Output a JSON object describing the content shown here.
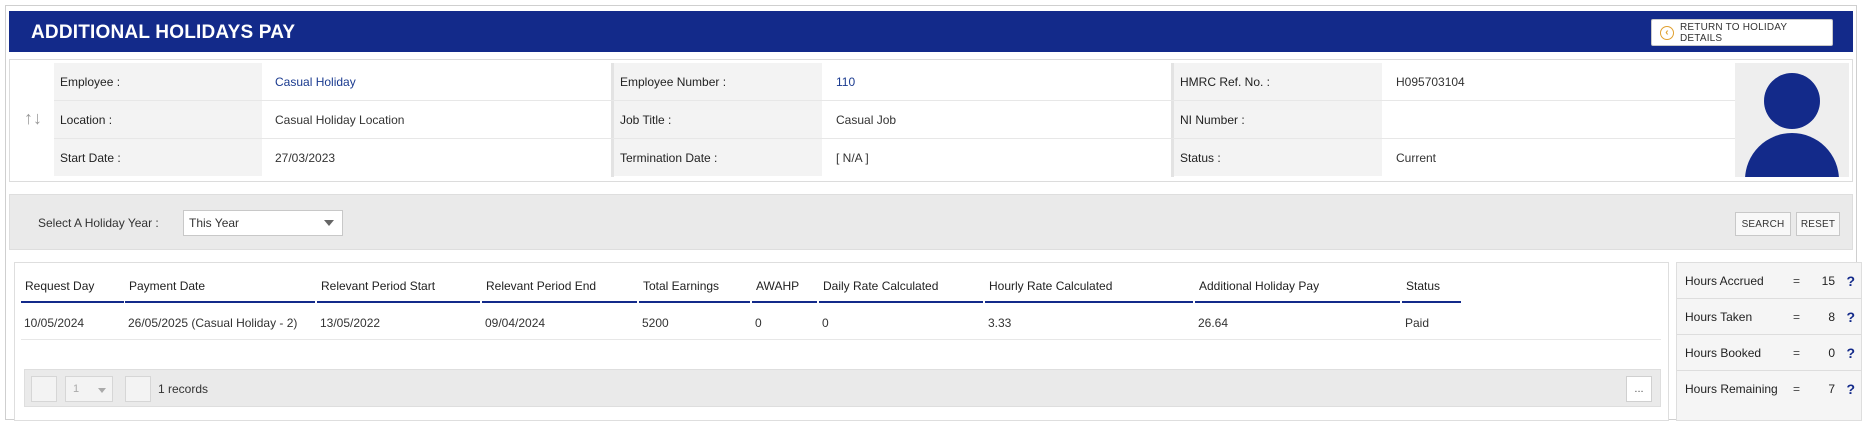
{
  "header": {
    "title": "ADDITIONAL HOLIDAYS PAY",
    "return_label": "RETURN TO HOLIDAY DETAILS",
    "return_icon": "chevron-left-circle-icon",
    "bar_color": "#132a8a"
  },
  "employee": {
    "rows": [
      [
        {
          "label": "Employee :",
          "value": "Casual Holiday"
        },
        {
          "label": "Employee Number :",
          "value": "110"
        },
        {
          "label": "HMRC Ref. No. :",
          "value": "H095703104"
        }
      ],
      [
        {
          "label": "Location :",
          "value": "Casual Holiday Location"
        },
        {
          "label": "Job Title :",
          "value": "Casual Job"
        },
        {
          "label": "NI Number :",
          "value": ""
        }
      ],
      [
        {
          "label": "Start Date :",
          "value": "27/03/2023"
        },
        {
          "label": "Termination Date :",
          "value": "[ N/A ]"
        },
        {
          "label": "Status :",
          "value": "Current"
        }
      ]
    ],
    "swap_icon": "↑↓",
    "avatar_icon": "user-silhouette-icon"
  },
  "filter": {
    "label": "Select A Holiday Year :",
    "selected": "This Year",
    "search_label": "SEARCH",
    "reset_label": "RESET"
  },
  "table": {
    "columns": [
      "Request Day",
      "Payment Date",
      "Relevant Period Start",
      "Relevant Period End",
      "Total Earnings",
      "AWAHP",
      "Daily Rate Calculated",
      "Hourly Rate Calculated",
      "Additional Holiday Pay",
      "Status"
    ],
    "rows": [
      [
        "10/05/2024",
        "26/05/2025 (Casual Holiday - 2)",
        "13/05/2022",
        "09/04/2024",
        "5200",
        "0",
        "0",
        "3.33",
        "26.64",
        "Paid"
      ]
    ],
    "pager": {
      "page": "1",
      "records_text": "1 records",
      "more_label": "..."
    }
  },
  "summary": [
    {
      "label": "Hours Accrued",
      "eq": "=",
      "value": "15",
      "help": "?"
    },
    {
      "label": "Hours Taken",
      "eq": "=",
      "value": "8",
      "help": "?"
    },
    {
      "label": "Hours Booked",
      "eq": "=",
      "value": "0",
      "help": "?"
    },
    {
      "label": "Hours Remaining",
      "eq": "=",
      "value": "7",
      "help": "?"
    }
  ]
}
